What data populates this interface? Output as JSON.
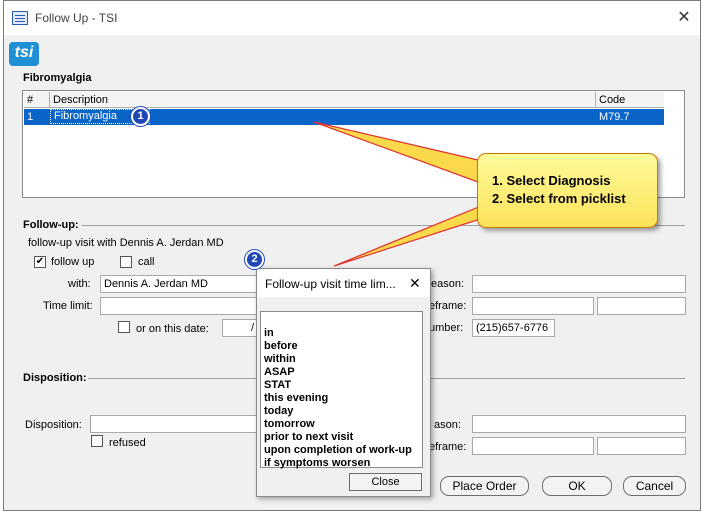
{
  "window": {
    "title": "Follow Up - TSI",
    "close": "✕"
  },
  "logo": "tsi",
  "diagnosis": {
    "heading": "Fibromyalgia",
    "columns": [
      "#",
      "Description",
      "Code"
    ],
    "rows": [
      {
        "num": "1",
        "description": "Fibromyalgia",
        "code": "M79.7"
      }
    ]
  },
  "followup": {
    "section": "Follow-up:",
    "visit_text": "follow-up visit with Dennis A. Jerdan MD",
    "follow_up_checked": "✔",
    "follow_up_label": "follow up",
    "call_label": "call",
    "with_label": "with:",
    "with_value": "Dennis A. Jerdan MD",
    "time_limit_label": "Time limit:",
    "on_date_label": "or on this date:",
    "date_value": "/",
    "reason_label": "eason:",
    "timeframe_label": "eframe:",
    "number_label": "umber:",
    "phone_value": "(215)657-6776"
  },
  "disposition": {
    "section": "Disposition:",
    "label": "Disposition:",
    "refused_label": "refused",
    "reason_label": "ason:",
    "timeframe_label": "eframe:"
  },
  "buttons": {
    "place_order": "Place Order",
    "ok": "OK",
    "cancel": "Cancel"
  },
  "callout": {
    "line1": "1. Select Diagnosis",
    "line2": "2. Select from picklist"
  },
  "badges": {
    "one": "1",
    "two": "2"
  },
  "popup": {
    "title": "Follow-up visit time lim...",
    "close": "✕",
    "items": [
      "in",
      "before",
      "within",
      "ASAP",
      "STAT",
      "this evening",
      "today",
      "tomorrow",
      "prior to next visit",
      "upon completion of work-up",
      "if symptoms worsen"
    ],
    "close_button": "Close"
  },
  "colors": {
    "selection": "#0a64c8",
    "callout": "#fbe25a",
    "badge": "#2047b8",
    "arrow": "#e03030"
  }
}
